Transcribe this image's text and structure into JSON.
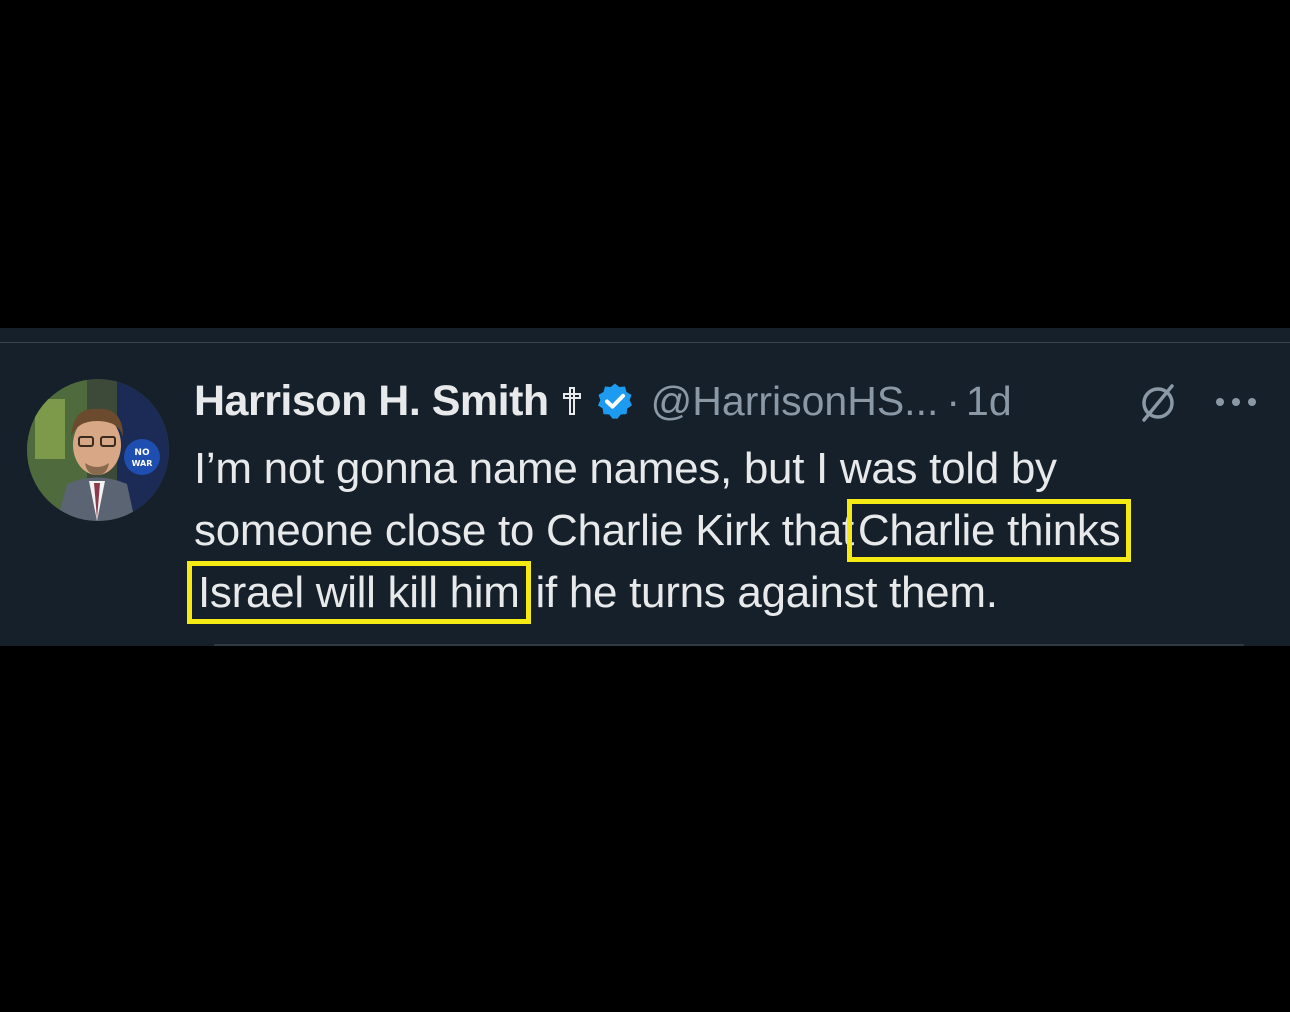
{
  "tweet": {
    "display_name": "Harrison H. Smith",
    "handle": "@HarrisonHS...",
    "separator": "·",
    "time": "1d",
    "avatar_badge_text": "NO WAR",
    "text_lines": [
      {
        "before": "I’m not gonna name names, but I was told by",
        "highlight": "",
        "after": ""
      },
      {
        "before": "someone close to Charlie Kirk that",
        "highlight": "Charlie thinks",
        "after": ""
      },
      {
        "before": "",
        "highlight": "Israel will kill him",
        "after": " if he turns against them."
      }
    ]
  },
  "icons": {
    "name_emoji": "cross-icon",
    "verified": "verified-badge-icon",
    "grok": "grok-icon",
    "more": "more-options-icon"
  },
  "colors": {
    "background": "#000000",
    "card": "#15202b",
    "primary_text": "#e7e9ea",
    "secondary_text": "#8b98a5",
    "verified_blue": "#1d9bf0",
    "highlight_box": "#f5ea14"
  }
}
